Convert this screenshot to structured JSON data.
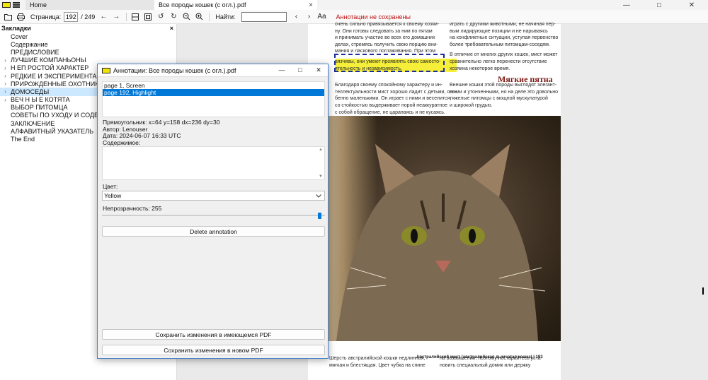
{
  "titlebar": {
    "tabs": [
      {
        "label": "Home"
      },
      {
        "label": "Все породы кошек (с огл.).pdf",
        "close": "×"
      }
    ],
    "controls": {
      "minimize": "—",
      "maximize": "□",
      "close": "✕"
    }
  },
  "toolbar": {
    "page_label": "Страница:",
    "page_value": "192",
    "page_total": "/ 249",
    "find_label": "Найти:",
    "find_value": "",
    "unsaved_status": "Аннотации не сохранены"
  },
  "bookmarks": {
    "title": "Закладки",
    "close": "×",
    "items": [
      {
        "label": "Cover",
        "expandable": false
      },
      {
        "label": "Содержание",
        "expandable": false
      },
      {
        "label": "ПРЕДИСЛОВИЕ",
        "expandable": false
      },
      {
        "label": "ЛУЧШИЕ КОМПАНЬОНЫ",
        "expandable": true
      },
      {
        "label": "Н ЕП РОСТОЙ ХАРАКТЕР",
        "expandable": true
      },
      {
        "label": "РЕДКИЕ И ЭКСПЕРИМЕНТАЛЬНЫЕ",
        "expandable": true
      },
      {
        "label": "ПРИРОЖДЕННЫЕ ОХОТНИКИ",
        "expandable": true
      },
      {
        "label": "ДОМОСЕДЫ",
        "expandable": true,
        "selected": true
      },
      {
        "label": "ВЕЧ Н Ы Е КОТЯТА",
        "expandable": true
      },
      {
        "label": "ВЫБОР ПИТОМЦА",
        "expandable": false
      },
      {
        "label": "СОВЕТЫ ПО УХОДУ И СОДЕРЖАНИЮ",
        "expandable": false
      },
      {
        "label": "ЗАКЛЮЧЕНИЕ",
        "expandable": false
      },
      {
        "label": "АЛФАВИТНЫЙ УКАЗАТЕЛЬ",
        "expandable": false
      },
      {
        "label": "The End",
        "expandable": false
      }
    ]
  },
  "document": {
    "left_col": [
      "очень сильно привязывается к своему хозяи-",
      "ну. Они готовы следовать за ним по пятам",
      "и принимать участие во всех его домашних",
      "делах, стремясь получить свою порцию вни-",
      "мания и ласкового поглаживания. При этом"
    ],
    "highlight_lines": [
      "вязчивы, они умеют проявлять свою самосто-",
      "ятельность и независимость."
    ],
    "left_col2": [
      "Благодаря своему спокойному характеру и ин-",
      "теллектуальности мист хорошо ладит с детьми, осо-",
      "бенно маленькими. Он играет с ними и веселится,",
      "со стойкостью выдерживает порой неаккуратное",
      "с собой обращение, не царапаясь и не кусаясь."
    ],
    "right_col": [
      "играть с другими животными, не начиная пер-",
      "вым лидирующие позиции и не нарываясь",
      "на конфликтные ситуации, уступая первенство",
      "более требовательным питомцам-соседям."
    ],
    "right_col2": [
      "В отличие от многих других кошек, мист может",
      "сравнительно легко перенести отсутствие",
      "хозяина некоторое время."
    ],
    "section_title": "Мягкие пятна",
    "right_col3": [
      "Внешне кошки этой породы выглядят элегант-",
      "ными и утонченными, но на деле это довольно",
      "тяжелые питомцы с мощной мускулатурой",
      "и широкой грудью."
    ],
    "caption": "Австралийский мист (австралийская дымчатая кошка) | 193",
    "bottom_left": [
      "Шерсть австралийской кошки недлинная,",
      "мягкая и блестящая. Цвет чубка на спине"
    ],
    "bottom_right": [
      "на возвышении, поэтому постарайтесь уста-",
      "новить специальный домик или держку"
    ]
  },
  "dialog": {
    "title": "Аннотации: Все породы кошек (с огл.).pdf",
    "controls": {
      "minimize": "—",
      "maximize": "□",
      "close": "✕"
    },
    "annotations": [
      {
        "label": "page 1, Screen",
        "selected": false
      },
      {
        "label": "page 192, Highlight",
        "selected": true
      }
    ],
    "rect": "Прямоугольник: x=64 y=158 dx=236 dy=30",
    "author": "Автор: Lenouser",
    "date": "Дата: 2024-06-07 16:33 UTC",
    "content_label": "Содержимое:",
    "content_value": "",
    "color_label": "Цвет:",
    "color_value": "Yellow",
    "opacity_label": "Непрозрачность: 255",
    "opacity_value": 255,
    "opacity_max": 255,
    "delete_button": "Delete annotation",
    "save_existing_button": "Сохранить изменения в имеющемся PDF",
    "save_new_button": "Сохранить изменения в новом PDF"
  },
  "colors": {
    "accent": "#0078d7",
    "highlight": "#f5ef3a",
    "unsaved": "#c01010",
    "heading": "#7b1a14"
  }
}
